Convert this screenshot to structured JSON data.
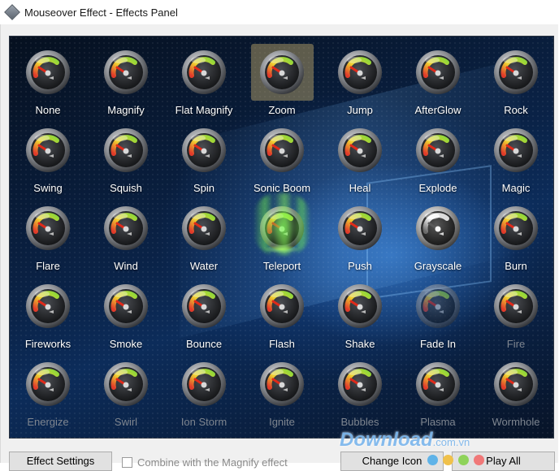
{
  "window": {
    "title": "Mouseover Effect - Effects Panel"
  },
  "effects": [
    {
      "label": "None"
    },
    {
      "label": "Magnify"
    },
    {
      "label": "Flat Magnify"
    },
    {
      "label": "Zoom",
      "selected": true
    },
    {
      "label": "Jump"
    },
    {
      "label": "AfterGlow"
    },
    {
      "label": "Rock"
    },
    {
      "label": "Swing"
    },
    {
      "label": "Squish"
    },
    {
      "label": "Spin"
    },
    {
      "label": "Sonic Boom"
    },
    {
      "label": "Heal"
    },
    {
      "label": "Explode"
    },
    {
      "label": "Magic"
    },
    {
      "label": "Flare"
    },
    {
      "label": "Wind"
    },
    {
      "label": "Water"
    },
    {
      "label": "Teleport"
    },
    {
      "label": "Push"
    },
    {
      "label": "Grayscale"
    },
    {
      "label": "Burn"
    },
    {
      "label": "Fireworks"
    },
    {
      "label": "Smoke"
    },
    {
      "label": "Bounce"
    },
    {
      "label": "Flash"
    },
    {
      "label": "Shake"
    },
    {
      "label": "Fade In"
    },
    {
      "label": "Fire",
      "dim": true
    },
    {
      "label": "Energize",
      "dim": true
    },
    {
      "label": "Swirl",
      "dim": true
    },
    {
      "label": "Ion Storm",
      "dim": true
    },
    {
      "label": "Ignite",
      "dim": true
    },
    {
      "label": "Bubbles",
      "dim": true
    },
    {
      "label": "Plasma",
      "dim": true
    },
    {
      "label": "Wormhole",
      "dim": true
    }
  ],
  "icon": "speedometer-gauge-icon",
  "controls": {
    "effect_settings_label": "Effect Settings",
    "combine_label": "Combine with the Magnify effect",
    "change_icon_label": "Change Icon",
    "play_all_label": "Play All"
  },
  "watermark": {
    "text": "Download",
    "suffix": ".com.vn"
  },
  "dot_colors": [
    "#5fb3e8",
    "#f0c14b",
    "#8fd35a",
    "#f07878"
  ]
}
